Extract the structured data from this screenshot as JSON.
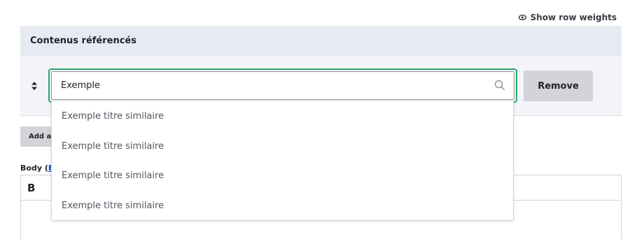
{
  "header": {
    "show_row_weights": "Show row weights"
  },
  "table": {
    "title": "Contenus référencés",
    "row": {
      "input_value": "Exemple",
      "remove_label": "Remove"
    }
  },
  "autocomplete": {
    "suggestions": [
      "Exemple titre similaire",
      "Exemple titre similaire",
      "Exemple titre similaire",
      "Exemple titre similaire"
    ]
  },
  "add_button": {
    "label": "Add a"
  },
  "body_field": {
    "label": "Body (",
    "link": "E"
  },
  "editor": {
    "bold": "B"
  },
  "colors": {
    "focus": "#26a769",
    "header_bg": "#e7eaf3",
    "row_bg": "#f3f4f9",
    "button_bg": "#d3d4d9",
    "link": "#003ecc"
  },
  "icons": [
    "eye-icon",
    "drag-handle-icon",
    "search-icon"
  ]
}
